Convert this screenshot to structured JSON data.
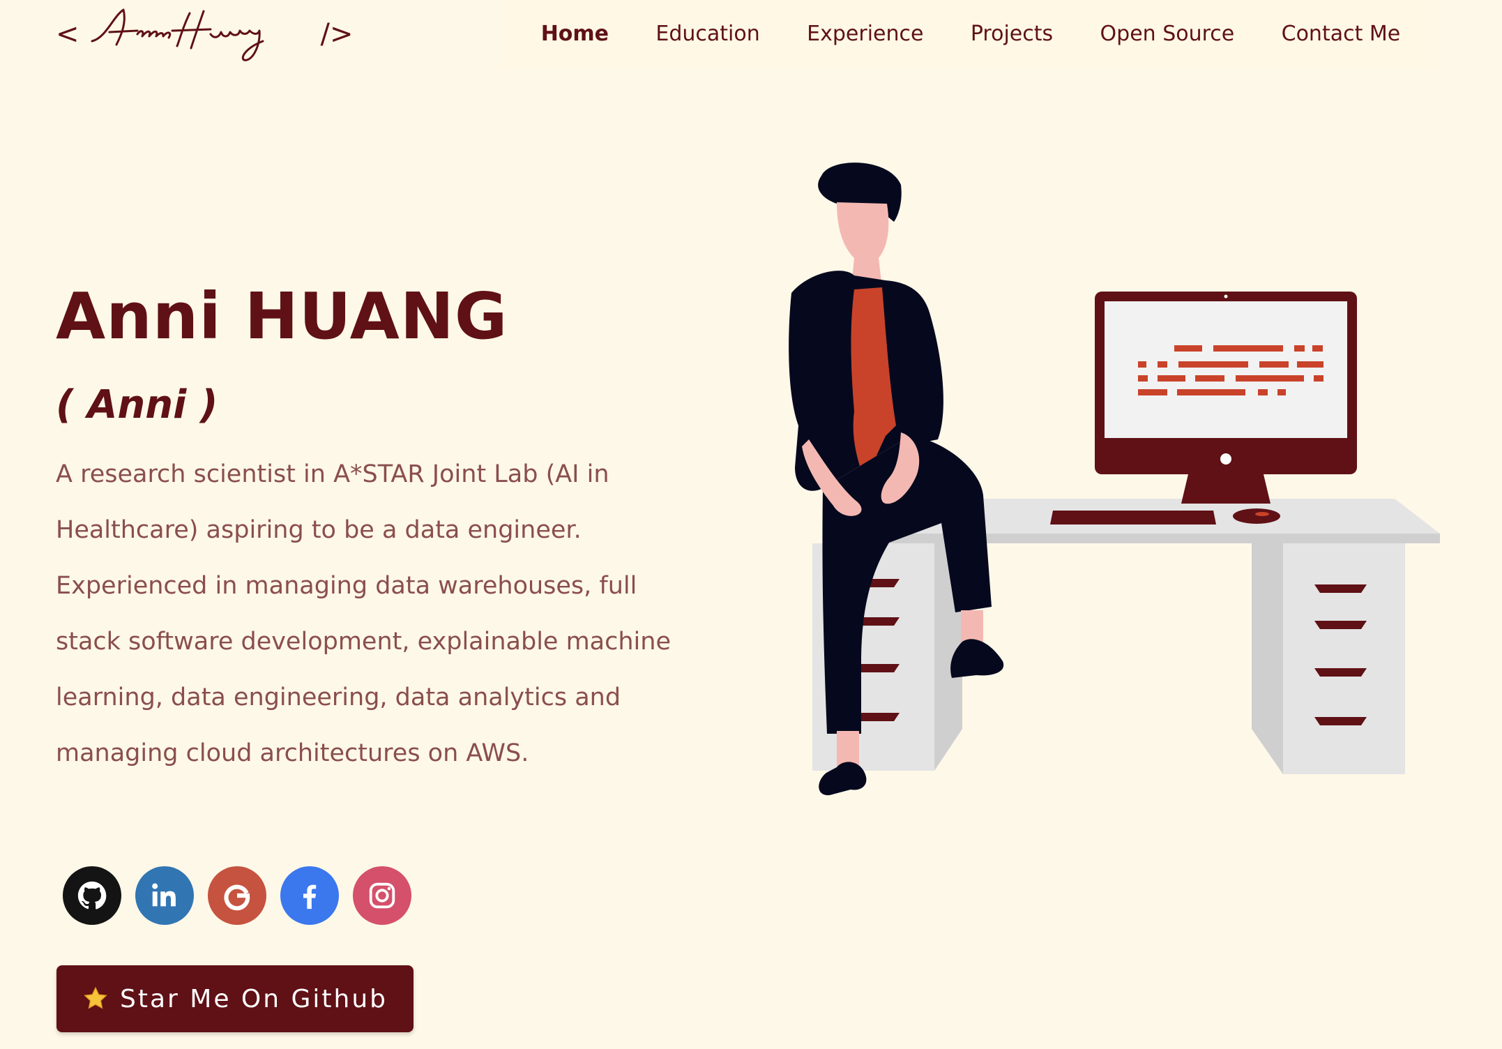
{
  "header": {
    "logo": {
      "open": "<",
      "signature_text": "Anni Huang",
      "close": "/>"
    },
    "nav": [
      {
        "label": "Home",
        "active": true
      },
      {
        "label": "Education",
        "active": false
      },
      {
        "label": "Experience",
        "active": false
      },
      {
        "label": "Projects",
        "active": false
      },
      {
        "label": "Open Source",
        "active": false
      },
      {
        "label": "Contact Me",
        "active": false
      }
    ]
  },
  "hero": {
    "name": "Anni HUANG",
    "nickname": "( Anni )",
    "description": "A research scientist in A*STAR Joint Lab (AI in Healthcare) aspiring to be a data engineer. Experienced in managing data warehouses, full stack software development, explainable machine learning, data engineering, data analytics and managing cloud architectures on AWS."
  },
  "socials": [
    {
      "icon": "github-icon",
      "color": "#141414"
    },
    {
      "icon": "linkedin-icon",
      "color": "#3275b3"
    },
    {
      "icon": "google-icon",
      "color": "#c6533f"
    },
    {
      "icon": "facebook-icon",
      "color": "#3b78ee"
    },
    {
      "icon": "instagram-icon",
      "color": "#d4506b"
    }
  ],
  "cta": {
    "label": "Star Me On Github",
    "icon": "star-icon"
  },
  "colors": {
    "primary": "#5f1116",
    "text_muted": "#8a4e4e",
    "background": "#fef8e8",
    "accent_orange": "#c9432a"
  }
}
